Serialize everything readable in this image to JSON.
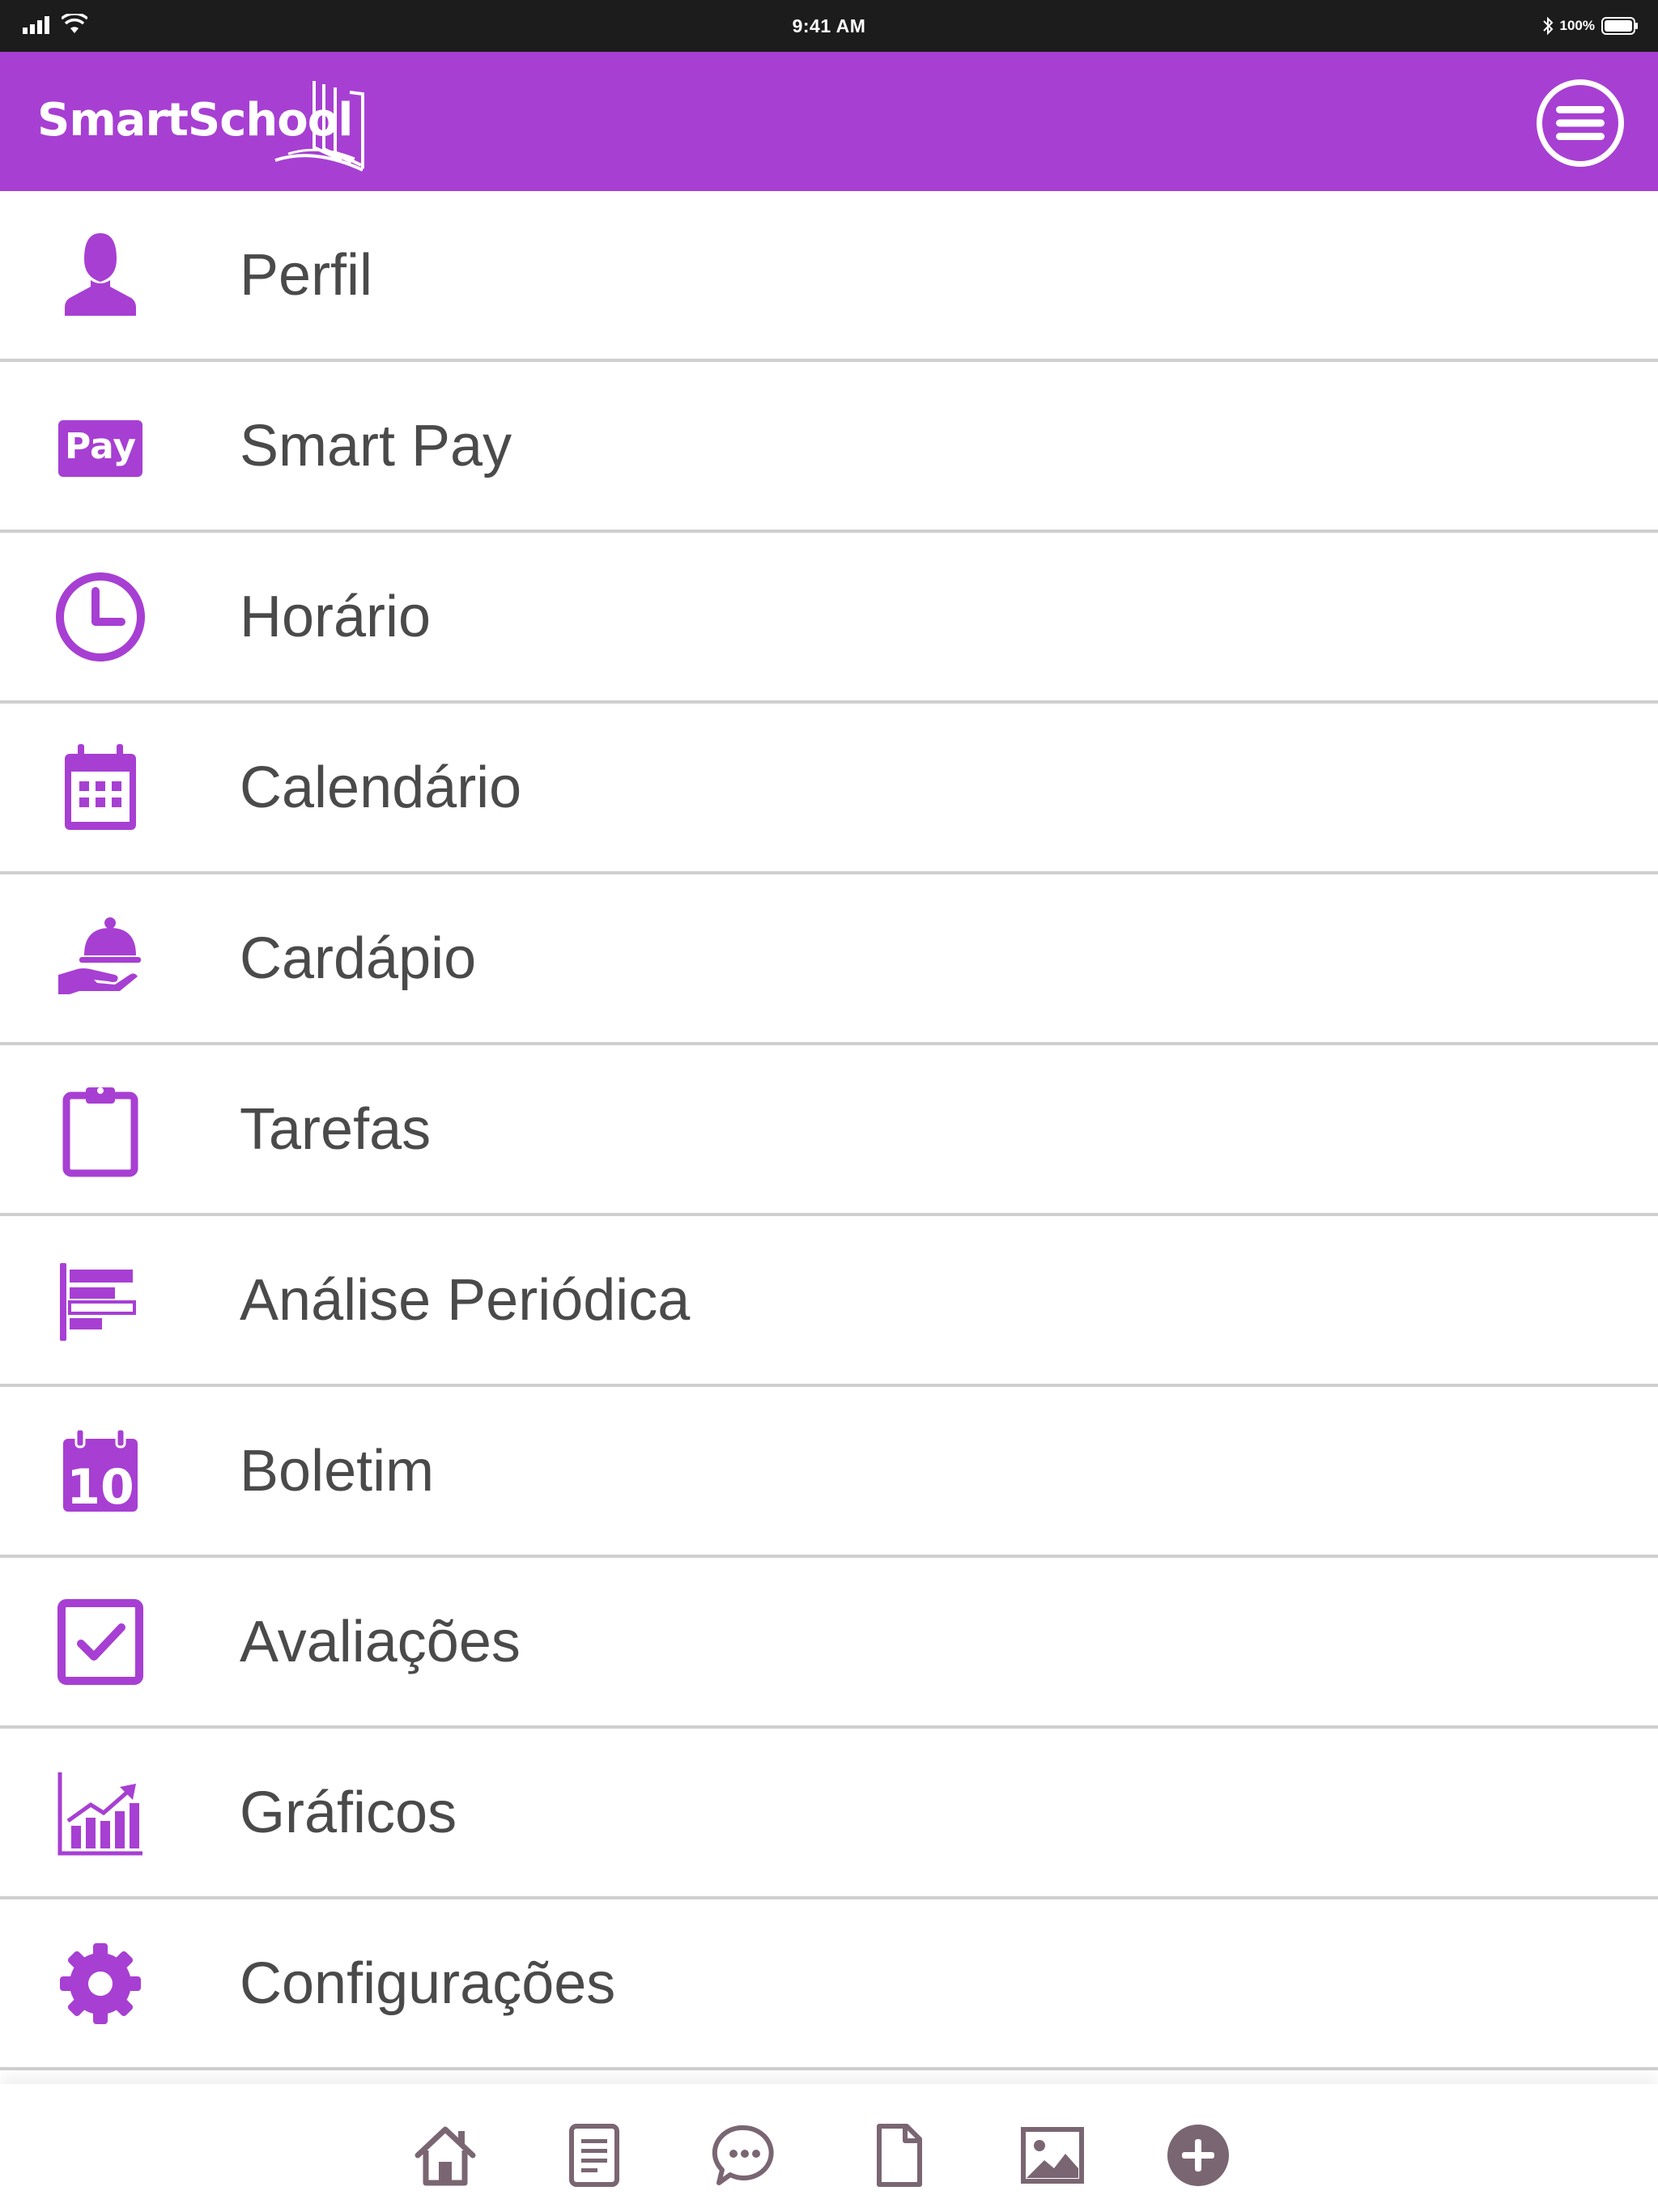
{
  "status_bar": {
    "time": "9:41 AM",
    "battery_percent": "100%",
    "icons": [
      "signal-icon",
      "wifi-icon",
      "bluetooth-icon",
      "battery-icon"
    ]
  },
  "header": {
    "logo_text": "SmartSchool",
    "menu_button_icon": "hamburger-icon"
  },
  "colors": {
    "accent": "#a73fd3",
    "text": "#4a4a4a",
    "divider": "#cfcfcf",
    "tab_icon": "#7a6672"
  },
  "menu": {
    "items": [
      {
        "label": "Perfil",
        "icon": "user-icon"
      },
      {
        "label": "Smart Pay",
        "icon": "pay-icon",
        "icon_text": "Pay"
      },
      {
        "label": "Horário",
        "icon": "clock-icon"
      },
      {
        "label": "Calendário",
        "icon": "calendar-icon"
      },
      {
        "label": "Cardápio",
        "icon": "cloche-icon"
      },
      {
        "label": "Tarefas",
        "icon": "clipboard-icon"
      },
      {
        "label": "Análise Periódica",
        "icon": "bar-list-icon"
      },
      {
        "label": "Boletim",
        "icon": "report-card-icon",
        "icon_text": "10"
      },
      {
        "label": "Avaliações",
        "icon": "checkbox-icon"
      },
      {
        "label": "Gráficos",
        "icon": "chart-icon"
      },
      {
        "label": "Configurações",
        "icon": "gear-icon"
      }
    ]
  },
  "tab_bar": {
    "tabs": [
      "home-icon",
      "notes-icon",
      "chat-icon",
      "document-icon",
      "image-icon",
      "add-icon"
    ]
  }
}
